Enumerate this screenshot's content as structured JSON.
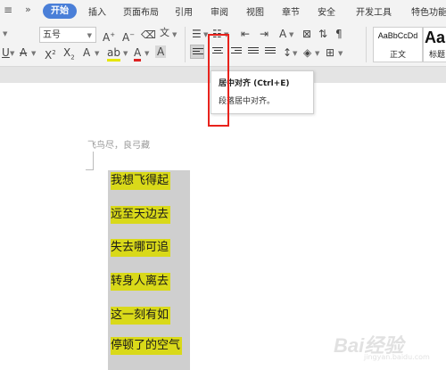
{
  "menubar": {
    "hamburger": "≡",
    "chevron": "»",
    "tabs": [
      "开始",
      "插入",
      "页面布局",
      "引用",
      "审阅",
      "视图",
      "章节",
      "安全",
      "开发工具",
      "特色功能"
    ]
  },
  "toolbar": {
    "font_size_value": "五号",
    "styles": [
      {
        "sample": "AaBbCcDd",
        "name": "正文"
      },
      {
        "sample": "Aa",
        "name": "标题"
      }
    ]
  },
  "tooltip": {
    "title": "居中对齐 (Ctrl+E)",
    "description": "段落居中对齐。"
  },
  "document": {
    "heading_line": "飞鸟尽，良弓藏",
    "lines": [
      "我想飞得起",
      "远至天边去",
      "失去哪可追",
      "转身人离去",
      "这一刻有如",
      "停顿了的空气"
    ]
  },
  "watermark": {
    "text": "Bai经验",
    "sub": "jingyan.baidu.com"
  },
  "colors": {
    "accent": "#4a7fd8",
    "highlight_box": "#e8221c",
    "text_highlight": "#d9d919"
  }
}
